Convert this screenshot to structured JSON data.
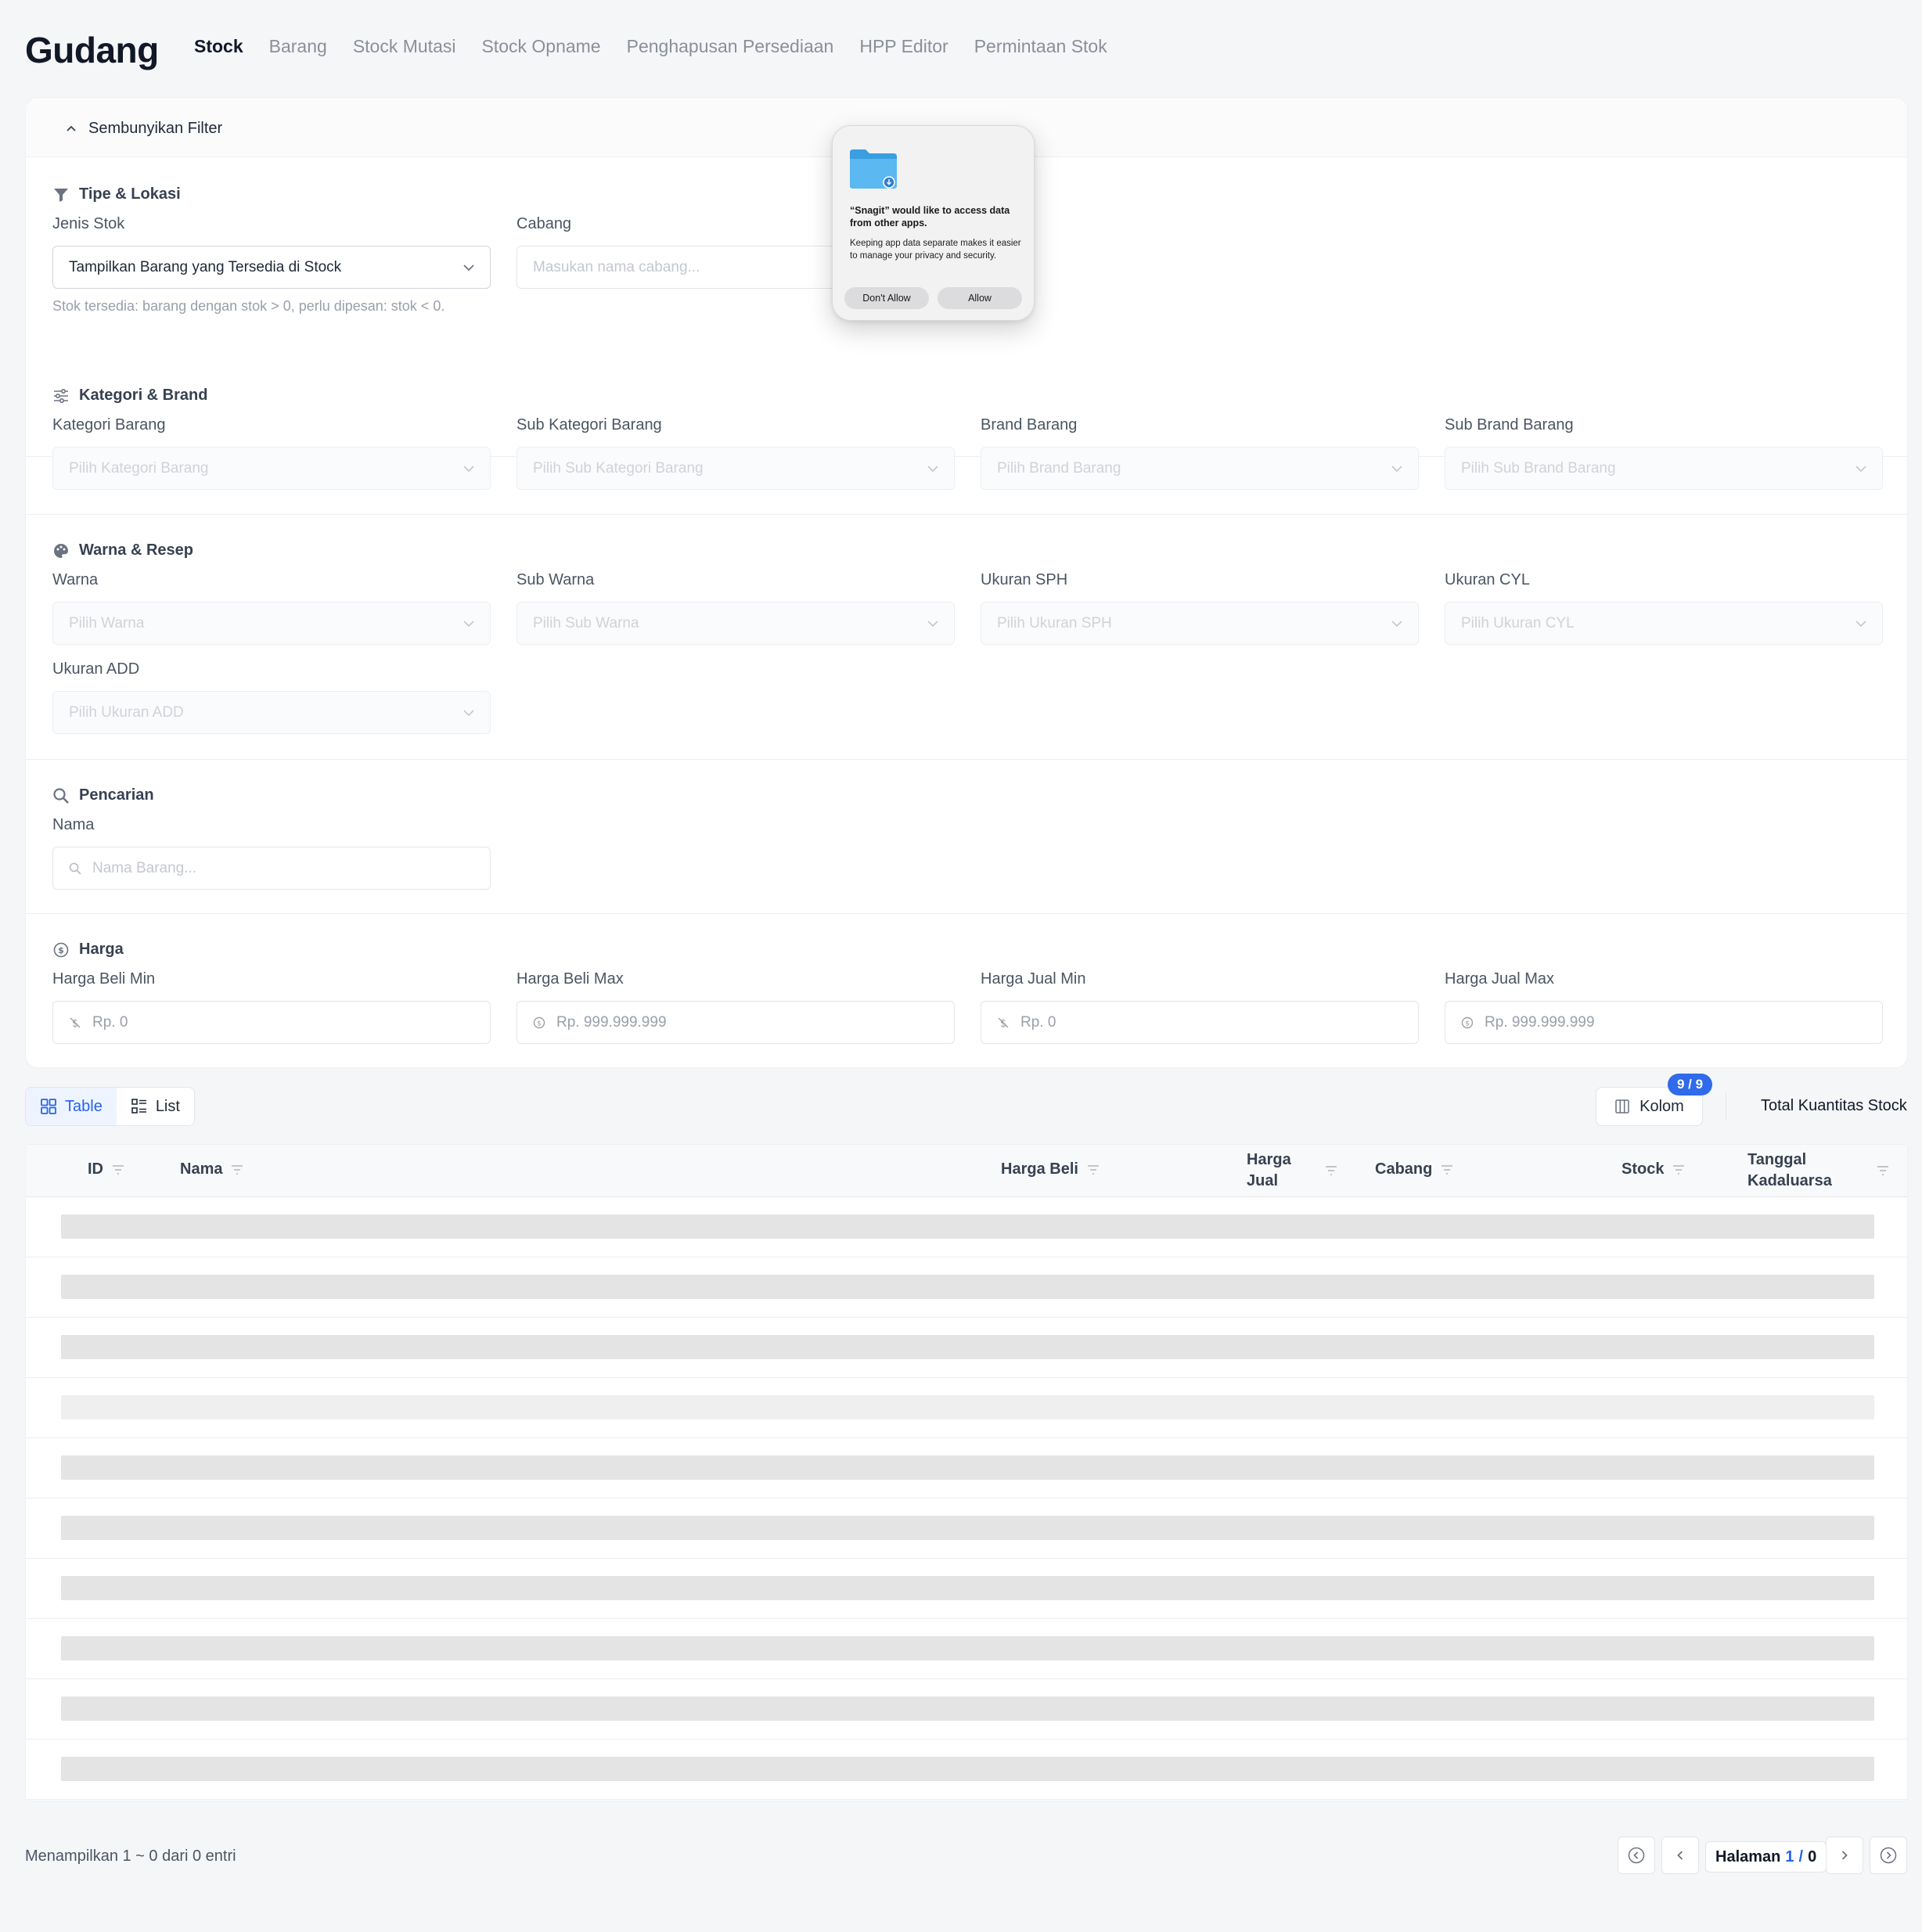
{
  "app": {
    "title": "Gudang"
  },
  "nav": {
    "items": [
      {
        "label": "Stock",
        "active": true
      },
      {
        "label": "Barang"
      },
      {
        "label": "Stock Mutasi"
      },
      {
        "label": "Stock Opname"
      },
      {
        "label": "Penghapusan Persediaan"
      },
      {
        "label": "HPP Editor"
      },
      {
        "label": "Permintaan Stok"
      }
    ]
  },
  "filter": {
    "toggle_label": "Sembunyikan Filter",
    "sections": {
      "tipe": {
        "title": "Tipe & Lokasi",
        "jenis_label": "Jenis Stok",
        "jenis_value": "Tampilkan Barang yang Tersedia di Stock",
        "jenis_helper": "Stok tersedia: barang dengan stok > 0, perlu dipesan: stok < 0.",
        "cabang_label": "Cabang",
        "cabang_placeholder": "Masukan nama cabang..."
      },
      "kategori": {
        "title": "Kategori & Brand",
        "fields": [
          {
            "label": "Kategori Barang",
            "placeholder": "Pilih Kategori Barang"
          },
          {
            "label": "Sub Kategori Barang",
            "placeholder": "Pilih Sub Kategori Barang"
          },
          {
            "label": "Brand Barang",
            "placeholder": "Pilih Brand Barang"
          },
          {
            "label": "Sub Brand Barang",
            "placeholder": "Pilih Sub Brand Barang"
          }
        ]
      },
      "warna": {
        "title": "Warna & Resep",
        "fields": [
          {
            "label": "Warna",
            "placeholder": "Pilih Warna"
          },
          {
            "label": "Sub Warna",
            "placeholder": "Pilih Sub Warna"
          },
          {
            "label": "Ukuran SPH",
            "placeholder": "Pilih Ukuran SPH"
          },
          {
            "label": "Ukuran CYL",
            "placeholder": "Pilih Ukuran CYL"
          },
          {
            "label": "Ukuran ADD",
            "placeholder": "Pilih Ukuran ADD"
          }
        ]
      },
      "pencarian": {
        "title": "Pencarian",
        "nama_label": "Nama",
        "nama_placeholder": "Nama Barang..."
      },
      "harga": {
        "title": "Harga",
        "fields": [
          {
            "label": "Harga Beli Min",
            "placeholder": "Rp. 0"
          },
          {
            "label": "Harga Beli Max",
            "placeholder": "Rp. 999.999.999"
          },
          {
            "label": "Harga Jual Min",
            "placeholder": "Rp. 0"
          },
          {
            "label": "Harga Jual Max",
            "placeholder": "Rp. 999.999.999"
          }
        ]
      }
    }
  },
  "toolbar": {
    "view_table": "Table",
    "view_list": "List",
    "kolom_label": "Kolom",
    "kolom_badge": "9 / 9",
    "total_label": "Total Kuantitas Stock"
  },
  "table": {
    "columns": [
      "ID",
      "Nama",
      "Harga Beli",
      "Harga Jual",
      "Cabang",
      "Stock",
      "Tanggal Kadaluarsa"
    ],
    "loading_rows": 10
  },
  "footer": {
    "summary": "Menampilkan 1 ~ 0 dari 0 entri",
    "page_prefix": "Halaman",
    "page_current": "1",
    "page_sep": "/",
    "page_total": "0"
  },
  "dialog": {
    "title": "“Snagit” would like to access data from other apps.",
    "body": "Keeping app data separate makes it easier to manage your privacy and security.",
    "deny_label": "Don't Allow",
    "allow_label": "Allow",
    "icon": "folder-icon"
  }
}
